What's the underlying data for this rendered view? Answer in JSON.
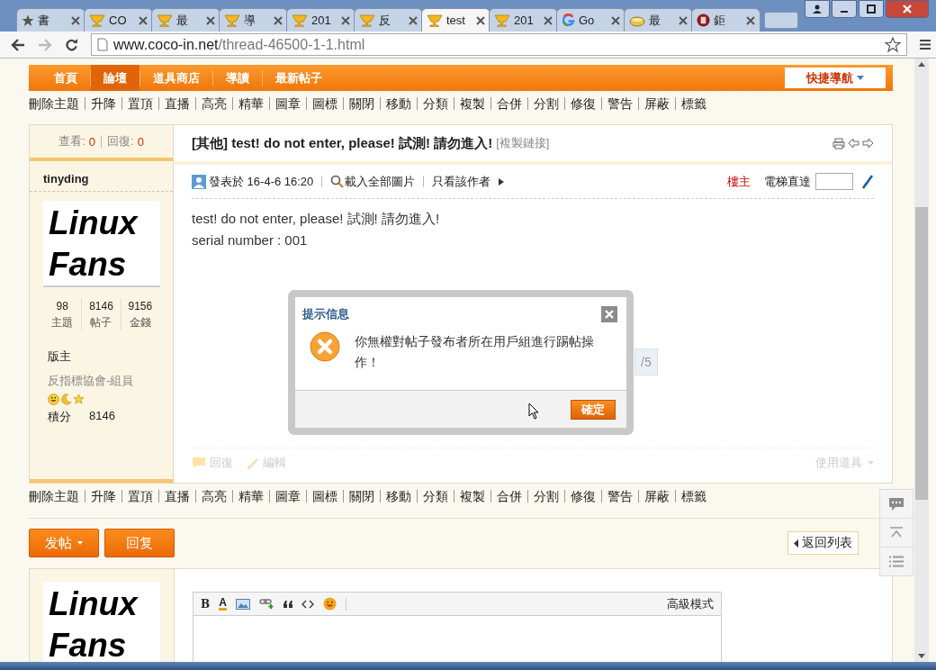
{
  "tabs": [
    {
      "label": "書",
      "kind": "star",
      "selected": false
    },
    {
      "label": "CO",
      "kind": "cup",
      "selected": false
    },
    {
      "label": "最",
      "kind": "cup",
      "selected": false
    },
    {
      "label": "導",
      "kind": "cup",
      "selected": false
    },
    {
      "label": "201",
      "kind": "cup",
      "selected": false
    },
    {
      "label": "反",
      "kind": "cup",
      "selected": false
    },
    {
      "label": "test",
      "kind": "cup",
      "selected": true
    },
    {
      "label": "201",
      "kind": "cup",
      "selected": false
    },
    {
      "label": "Go",
      "kind": "g",
      "selected": false
    },
    {
      "label": "最",
      "kind": "bowl",
      "selected": false
    },
    {
      "label": "鉅",
      "kind": "seal",
      "selected": false
    }
  ],
  "address": {
    "host": "www.coco-in.net",
    "path": "/thread-46500-1-1.html"
  },
  "nav": {
    "items": [
      {
        "label": "首頁",
        "selected": false
      },
      {
        "label": "論壇",
        "selected": true
      },
      {
        "label": "道具商店",
        "selected": false
      },
      {
        "label": "導讀",
        "selected": false
      },
      {
        "label": "最新帖子",
        "selected": false
      }
    ],
    "quick_nav": "快捷導航"
  },
  "admin_bar_top": [
    "刪除主題",
    "升降",
    "置頂",
    "直播",
    "高亮",
    "精華",
    "圖章",
    "圖標",
    "關閉",
    "移動",
    "分類",
    "複製",
    "合併",
    "分割",
    "修復",
    "警告",
    "屏蔽",
    "標籤"
  ],
  "thread": {
    "views_label": "查看:",
    "views": "0",
    "replies_label": "回復:",
    "replies": "0",
    "title": "[其他] test! do not enter, please! 試測! 請勿進入!",
    "copy_link": "[複製鏈接]"
  },
  "post": {
    "author": "tinyding",
    "avatar_text": "Linux Fans",
    "stats": [
      {
        "value": "98",
        "label": "主題"
      },
      {
        "value": "8146",
        "label": "帖子"
      },
      {
        "value": "9156",
        "label": "金錢"
      }
    ],
    "rank": "版主",
    "group": "反指標協會-組員",
    "points_label": "積分",
    "points": "8146",
    "posted": "發表於 16-4-6 16:20",
    "load_images": "載入全部圖片",
    "author_only": "只看該作者",
    "op_badge": "樓主",
    "jump_label": "電梯直達",
    "body": [
      "test! do not enter, please! 試測! 請勿進入!",
      "serial number : 001"
    ],
    "pager": "/5",
    "actions": [
      {
        "kind": "reply",
        "label": "回復"
      },
      {
        "kind": "edit",
        "label": "編輯"
      }
    ],
    "tools": "使用道具"
  },
  "admin_bar_bottom": [
    "刪除主題",
    "升降",
    "置頂",
    "直播",
    "高亮",
    "精華",
    "圖章",
    "圖標",
    "關閉",
    "移動",
    "分類",
    "複製",
    "合併",
    "分割",
    "修復",
    "警告",
    "屏蔽",
    "標籤"
  ],
  "buttons": {
    "new_post": "发帖",
    "reply": "回复",
    "back": "返回列表"
  },
  "reply_box": {
    "avatar_text": "Linux Fans",
    "toolbar": [
      {
        "kind": "bold",
        "text": "B"
      },
      {
        "kind": "color",
        "text": "A"
      },
      {
        "kind": "image"
      },
      {
        "kind": "link"
      },
      {
        "kind": "quote"
      },
      {
        "kind": "code"
      },
      {
        "kind": "emoji"
      }
    ],
    "mode": "高級模式"
  },
  "dialog": {
    "title": "提示信息",
    "message": "你無權對帖子發布者所在用戶組進行踢帖操作！",
    "ok": "確定"
  }
}
